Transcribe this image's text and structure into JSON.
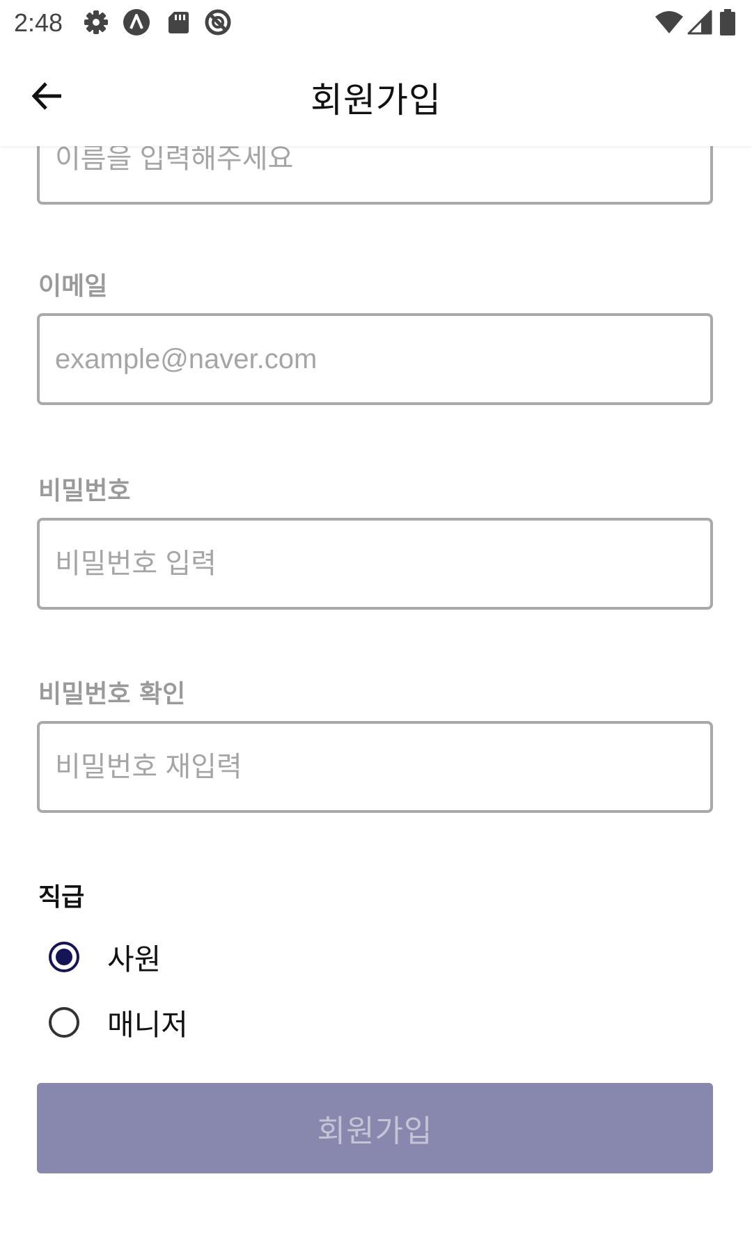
{
  "status_bar": {
    "time": "2:48",
    "left_icons": [
      "gear-icon",
      "a-badge-icon",
      "sd-card-icon",
      "do-not-disturb-icon"
    ],
    "right_icons": [
      "wifi-icon",
      "cell-signal-icon",
      "battery-icon"
    ]
  },
  "app_bar": {
    "title": "회원가입",
    "back_icon": "arrow-left-icon"
  },
  "form": {
    "name_field": {
      "placeholder": "이름을 입력해주세요",
      "value": ""
    },
    "email_field": {
      "label": "이메일",
      "placeholder": "example@naver.com",
      "value": ""
    },
    "password_field": {
      "label": "비밀번호",
      "placeholder": "비밀번호 입력",
      "value": ""
    },
    "password_confirm_field": {
      "label": "비밀번호 확인",
      "placeholder": "비밀번호 재입력",
      "value": ""
    },
    "position": {
      "label": "직급",
      "options": [
        {
          "label": "사원",
          "selected": true
        },
        {
          "label": "매니저",
          "selected": false
        }
      ]
    },
    "submit_label": "회원가입"
  },
  "colors": {
    "radio_accent": "#151556",
    "submit_background": "#8887ad",
    "submit_text": "#c4c4d6",
    "field_border": "#a9a9a9",
    "label_gray": "#9a9a9a"
  }
}
